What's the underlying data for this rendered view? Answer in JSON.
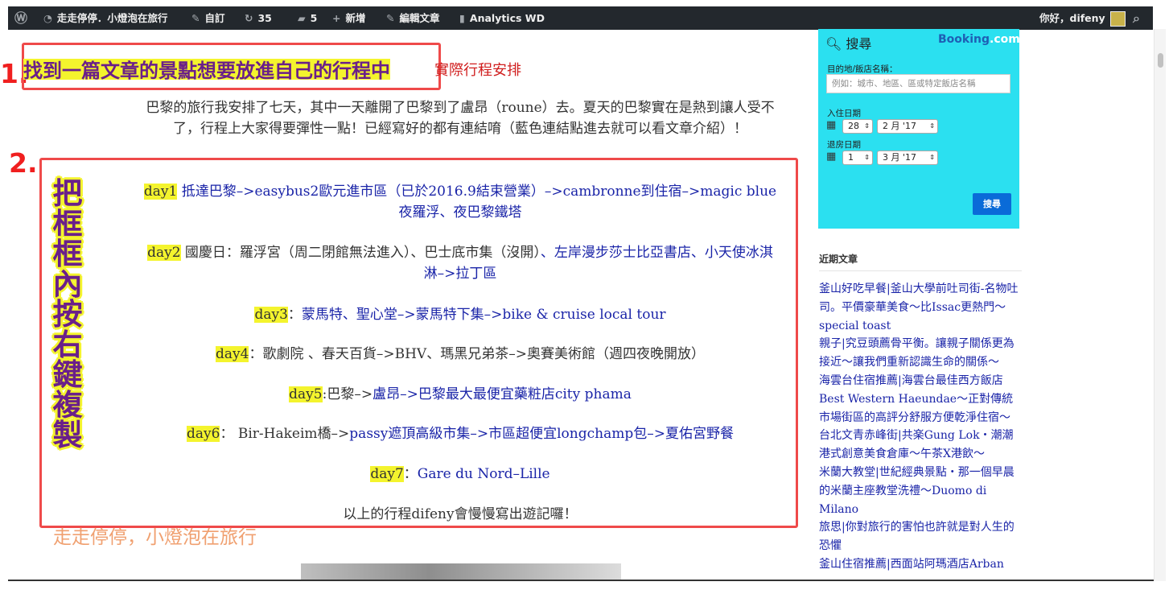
{
  "admin_bar": {
    "site_name": "走走停停．小燈泡在旅行",
    "customize": "自訂",
    "updates_count": "35",
    "comments_count": "5",
    "new_label": "新增",
    "edit_post": "編輯文章",
    "analytics": "Analytics WD",
    "greeting": "你好，difeny"
  },
  "annotations": {
    "step1_number": "1.",
    "step1_text": "找到一篇文章的景點想要放進自己的行程中",
    "step2_number": "2.",
    "step2_text": "把框框內按右鍵複製"
  },
  "post": {
    "title_tail": "實際行程安排",
    "intro": "巴黎的旅行我安排了七天，其中一天離開了巴黎到了盧昂（roune）去。夏天的巴黎實在是熱到讓人受不了，行程上大家得要彈性一點！已經寫好的都有連結唷（藍色連結點進去就可以看文章介紹）！",
    "days": [
      {
        "label": "day1",
        "segments": [
          {
            "text": " 抵達巴黎–>easybus2歐元進市區（已於2016.9結束營業）–>cambronne到住宿–>magic blue 夜羅浮、夜巴黎鐵塔",
            "link": true
          }
        ]
      },
      {
        "label": "day2",
        "segments": [
          {
            "text": " 國慶日：羅浮宮（周二閉館無法進入）、巴士底市集（沒開）",
            "link": false
          },
          {
            "text": "、左岸漫步莎士比亞書店、小天使冰淇淋–>拉丁區",
            "link": true
          }
        ]
      },
      {
        "label": "day3",
        "segments": [
          {
            "text": "：",
            "link": false
          },
          {
            "text": "蒙馬特、聖心堂–>蒙馬特下集–>bike & cruise local tour",
            "link": true
          }
        ]
      },
      {
        "label": "day4",
        "segments": [
          {
            "text": "：歌劇院 、春天百貨–>BHV、瑪黑兄弟茶–>奧賽美術館（週四夜晚開放）",
            "link": false
          }
        ]
      },
      {
        "label": "day5",
        "segments": [
          {
            "text": ":巴黎–>",
            "link": false
          },
          {
            "text": "盧昂–>巴黎最大最便宜藥粧店city phama",
            "link": true
          }
        ]
      },
      {
        "label": "day6",
        "segments": [
          {
            "text": "： Bir-Hakeim橋–>",
            "link": false
          },
          {
            "text": "passy遮頂高級市集–>市區超便宜longchamp包–>夏佑宮野餐",
            "link": true
          }
        ]
      },
      {
        "label": "day7",
        "segments": [
          {
            "text": "：",
            "link": false
          },
          {
            "text": "Gare du Nord–Lille",
            "link": true
          }
        ]
      }
    ],
    "outro": "以上的行程difeny會慢慢寫出遊記囉！",
    "watermark": "走走停停，小燈泡在旅行"
  },
  "booking_widget": {
    "search_label": "搜尋",
    "brand_name": "Booking",
    "brand_suffix": ".com",
    "destination_label": "目的地/飯店名稱：",
    "destination_placeholder": "例如：城市、地區、區或特定飯店名稱",
    "checkin_label": "入住日期",
    "checkin_day": "28",
    "checkin_month": "2 月 '17",
    "checkout_label": "退房日期",
    "checkout_day": "1",
    "checkout_month": "3 月 '17",
    "search_button": "搜尋",
    "bg_color": "#2be0f0",
    "button_color": "#0a6bd8"
  },
  "sidebar": {
    "recent_title": "近期文章",
    "recent_posts": [
      "釜山好吃早餐|釜山大學前吐司街-名物吐司。平價豪華美食～比Issac更熱門～special toast",
      "親子|究豆頭薦骨平衡。讓親子關係更為接近～讓我們重新認識生命的關係～",
      "海雲台住宿推薦|海雲台最佳西方飯店Best Western Haeundae～正對傳統市場街區的高評分舒服方便乾淨住宿～",
      "台北文青赤峰街|共楽Gung Lok・潮潮港式創意美食倉庫～午茶X港飲～",
      "米蘭大教堂|世紀經典景點・那一個早晨的米蘭主座教堂洗禮～Duomo di Milano",
      "旅思|你對旅行的害怕也許就是對人生的恐懼",
      "釜山住宿推薦|西面站阿瑪酒店Arban"
    ]
  },
  "colors": {
    "annotation_red": "#ef4a4a",
    "highlight_yellow": "#f4f42d",
    "link_blue": "#1a24a8"
  }
}
